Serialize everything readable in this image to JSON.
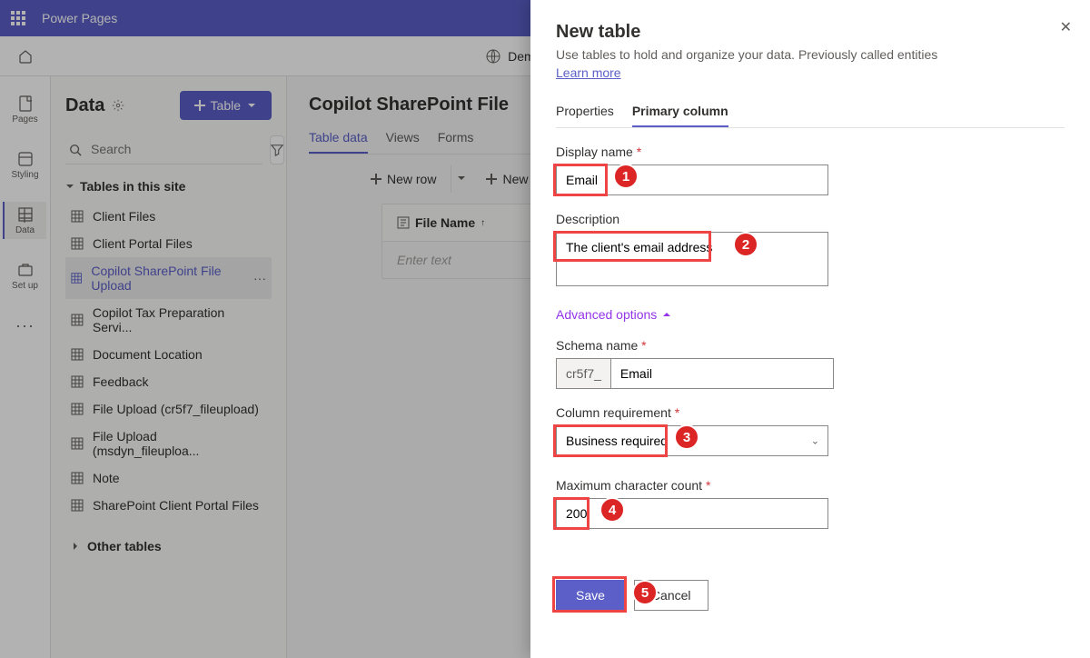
{
  "app_title": "Power Pages",
  "site_info": "Demo Site - Public - S",
  "rail": {
    "pages": "Pages",
    "styling": "Styling",
    "data": "Data",
    "setup": "Set up"
  },
  "data_sidebar": {
    "title": "Data",
    "table_button": "Table",
    "search_placeholder": "Search",
    "section_tables": "Tables in this site",
    "section_other": "Other tables",
    "tables": [
      "Client Files",
      "Client Portal Files",
      "Copilot SharePoint File Upload",
      "Copilot Tax Preparation Servi...",
      "Document Location",
      "Feedback",
      "File Upload (cr5f7_fileupload)",
      "File Upload (msdyn_fileuploa...",
      "Note",
      "SharePoint Client Portal Files"
    ]
  },
  "main": {
    "title": "Copilot SharePoint File",
    "tabs": [
      "Table data",
      "Views",
      "Forms"
    ],
    "toolbar": {
      "new_row": "New row",
      "new": "New"
    },
    "table": {
      "column_label": "File Name",
      "placeholder": "Enter text"
    }
  },
  "flyout": {
    "title": "New table",
    "description": "Use tables to hold and organize your data. Previously called entities",
    "learn_more": "Learn more",
    "tabs": [
      "Properties",
      "Primary column"
    ],
    "display_name_label": "Display name",
    "display_name_value": "Email",
    "description_label": "Description",
    "description_value": "The client's email address",
    "advanced_options": "Advanced options",
    "schema_name_label": "Schema name",
    "schema_prefix": "cr5f7_",
    "schema_value": "Email",
    "column_requirement_label": "Column requirement",
    "column_requirement_value": "Business required",
    "max_char_label": "Maximum character count",
    "max_char_value": "200",
    "save": "Save",
    "cancel": "Cancel"
  },
  "annotations": {
    "b1": "1",
    "b2": "2",
    "b3": "3",
    "b4": "4",
    "b5": "5"
  }
}
